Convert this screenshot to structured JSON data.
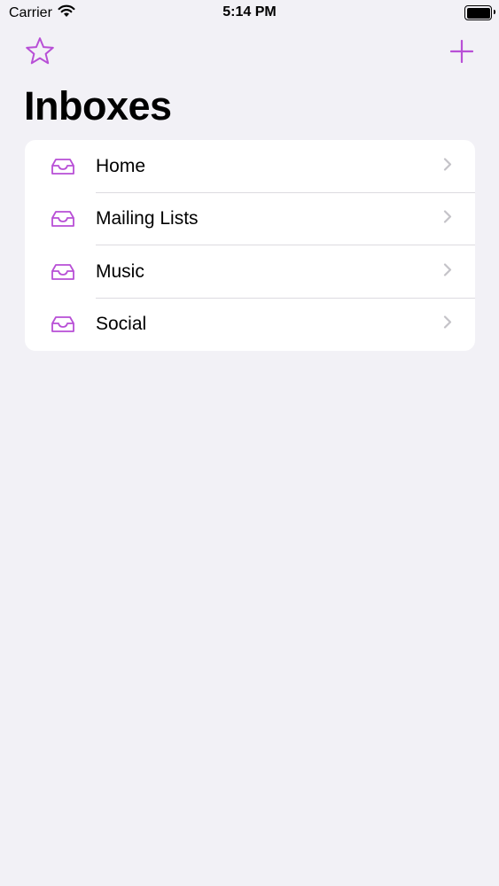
{
  "status_bar": {
    "carrier": "Carrier",
    "time": "5:14 PM",
    "wifi_icon": "wifi-icon",
    "battery_icon": "battery-full-icon"
  },
  "nav": {
    "left_icon": "star-icon",
    "right_icon": "plus-icon",
    "title": "Inboxes"
  },
  "inboxes": [
    {
      "label": "Home",
      "icon": "inbox-tray-icon"
    },
    {
      "label": "Mailing Lists",
      "icon": "inbox-tray-icon"
    },
    {
      "label": "Music",
      "icon": "inbox-tray-icon"
    },
    {
      "label": "Social",
      "icon": "inbox-tray-icon"
    }
  ],
  "colors": {
    "accent": "#b84fd6",
    "background": "#f2f1f6",
    "card": "#ffffff",
    "separator": "#dcdbe0",
    "chevron": "#c4c3c8"
  }
}
